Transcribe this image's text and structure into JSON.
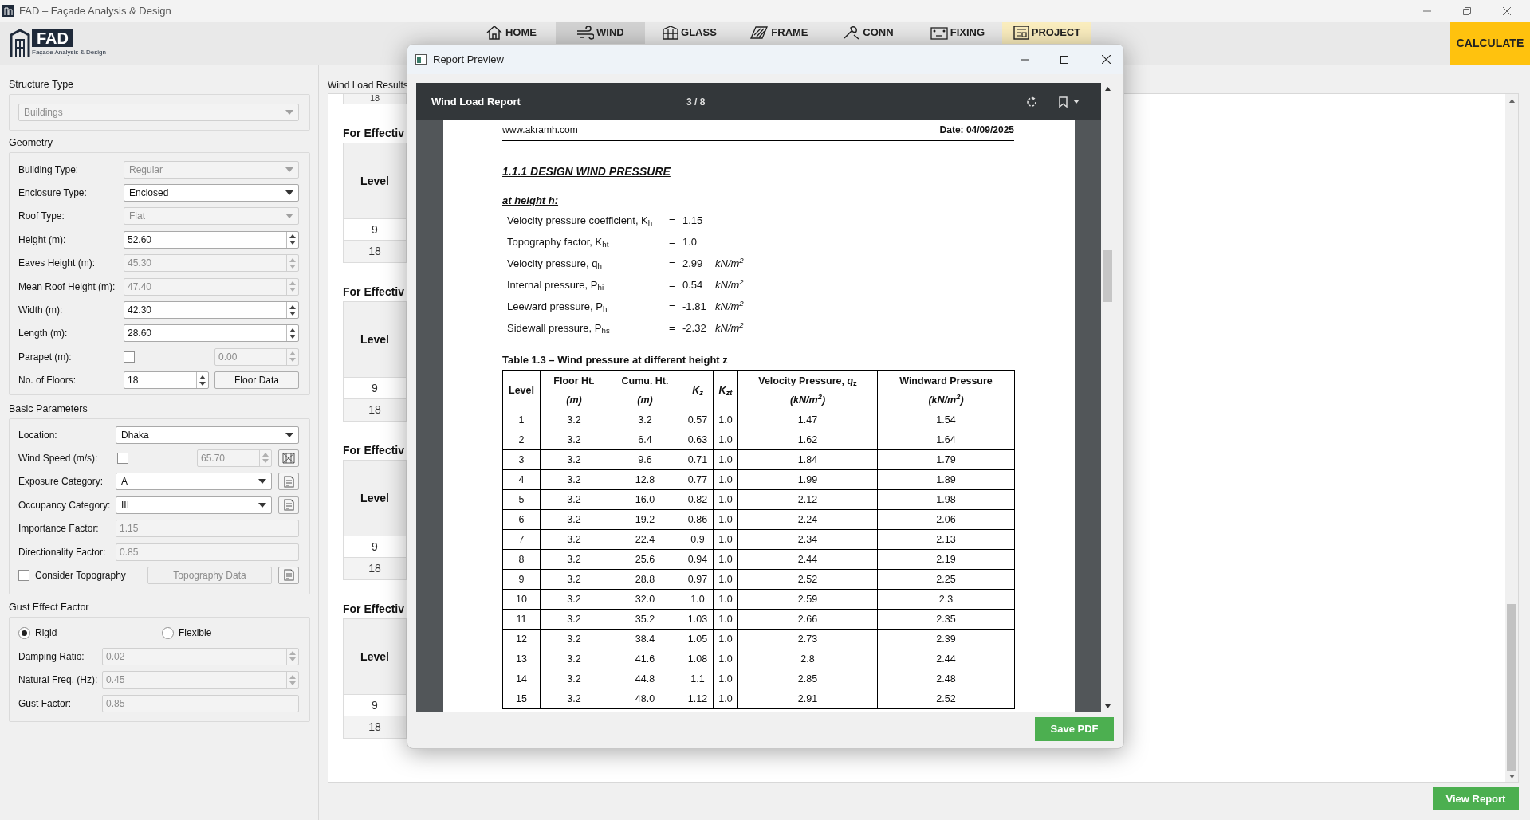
{
  "window": {
    "title": "FAD – Façade Analysis & Design"
  },
  "app_header": {
    "logo_text": "FAD",
    "logo_subtitle": "Façade Analysis & Design",
    "tabs": [
      {
        "label": "HOME",
        "selected": false,
        "highlighted": false
      },
      {
        "label": "WIND",
        "selected": true,
        "highlighted": false
      },
      {
        "label": "GLASS",
        "selected": false,
        "highlighted": false
      },
      {
        "label": "FRAME",
        "selected": false,
        "highlighted": false
      },
      {
        "label": "CONN",
        "selected": false,
        "highlighted": false
      },
      {
        "label": "FIXING",
        "selected": false,
        "highlighted": false
      },
      {
        "label": "PROJECT",
        "selected": false,
        "highlighted": true
      }
    ],
    "calculate_button": "CALCULATE"
  },
  "left_panel": {
    "groups": [
      {
        "title": "Structure Type",
        "rows": [
          {
            "kind": "combo",
            "value": "Buildings",
            "disabled": true
          }
        ]
      },
      {
        "title": "Geometry",
        "rows": [
          {
            "kind": "combo",
            "label": "Building Type:",
            "value": "Regular",
            "disabled": true
          },
          {
            "kind": "combo",
            "label": "Enclosure Type:",
            "value": "Enclosed",
            "disabled": false
          },
          {
            "kind": "combo",
            "label": "Roof Type:",
            "value": "Flat",
            "disabled": true
          },
          {
            "kind": "spin",
            "label": "Height (m):",
            "value": "52.60",
            "disabled": false
          },
          {
            "kind": "spin",
            "label": "Eaves Height (m):",
            "value": "45.30",
            "disabled": true
          },
          {
            "kind": "spin",
            "label": "Mean Roof Height (m):",
            "value": "47.40",
            "disabled": true
          },
          {
            "kind": "spin",
            "label": "Width (m):",
            "value": "42.30",
            "disabled": false
          },
          {
            "kind": "spin",
            "label": "Length (m):",
            "value": "28.60",
            "disabled": false
          },
          {
            "kind": "check_spin",
            "label": "Parapet (m):",
            "checked": false,
            "value": "0.00",
            "disabled": true
          },
          {
            "kind": "spin_button",
            "label": "No. of Floors:",
            "value": "18",
            "disabled": false,
            "button": "Floor Data"
          }
        ]
      },
      {
        "title": "Basic Parameters",
        "rows": [
          {
            "kind": "combo",
            "label": "Location:",
            "value": "Dhaka",
            "disabled": false
          },
          {
            "kind": "check_spin_map",
            "label": "Wind Speed (m/s):",
            "checked": false,
            "value": "65.70",
            "disabled": true
          },
          {
            "kind": "combo_doc",
            "label": "Exposure Category:",
            "value": "A",
            "disabled": false
          },
          {
            "kind": "combo_doc",
            "label": "Occupancy Category:",
            "value": "III",
            "disabled": false
          },
          {
            "kind": "text",
            "label": "Importance Factor:",
            "value": "1.15",
            "disabled": true
          },
          {
            "kind": "text",
            "label": "Directionality Factor:",
            "value": "0.85",
            "disabled": true
          },
          {
            "kind": "check_button_doc",
            "label": "Consider Topography",
            "checked": false,
            "button": "Topography Data",
            "disabled": true
          }
        ]
      },
      {
        "title": "Gust Effect Factor",
        "rows": [
          {
            "kind": "radios",
            "options": [
              {
                "label": "Rigid",
                "selected": true
              },
              {
                "label": "Flexible",
                "selected": false
              }
            ]
          },
          {
            "kind": "spin",
            "label": "Damping Ratio:",
            "value": "0.02",
            "disabled": true
          },
          {
            "kind": "spin",
            "label": "Natural Freq. (Hz):",
            "value": "0.45",
            "disabled": true
          },
          {
            "kind": "text",
            "label": "Gust Factor:",
            "value": "0.85",
            "disabled": true
          }
        ]
      }
    ]
  },
  "results": {
    "label": "Wind Load Results",
    "top_row": "18",
    "sections": [
      {
        "heading": "For Effectiv",
        "header": "Level",
        "rows": [
          "9",
          "18"
        ]
      },
      {
        "heading": "For Effectiv",
        "header": "Level",
        "rows": [
          "9",
          "18"
        ]
      },
      {
        "heading": "For Effectiv",
        "header": "Level",
        "rows": [
          "9",
          "18"
        ]
      },
      {
        "heading": "For Effectiv",
        "header": "Level",
        "rows": [
          "9",
          "18"
        ]
      }
    ],
    "view_report_button": "View Report"
  },
  "dialog": {
    "title": "Report Preview",
    "viewer": {
      "title": "Wind Load Report",
      "page_counter": "3 / 8"
    },
    "page": {
      "site": "www.akramh.com",
      "date": "Date: 04/09/2025",
      "heading": "1.1.1 DESIGN WIND PRESSURE",
      "subheading": "at height h:",
      "params": [
        {
          "label": "Velocity pressure coefficient, K$_{h}$",
          "sign": "=",
          "value": "1.15"
        },
        {
          "label": "Topography factor, K$_{ht}$",
          "sign": "=",
          "value": "1.0"
        },
        {
          "label": "Velocity pressure, q$_{h}$",
          "sign": "=",
          "value": "2.99",
          "unit": "kN/m$^{2}$"
        },
        {
          "label": "Internal pressure, P$_{hi}$",
          "sign": "=",
          "value": "0.54",
          "unit": "kN/m$^{2}$"
        },
        {
          "label": "Leeward pressure, P$_{hl}$",
          "sign": "=",
          "value": "-1.81",
          "unit": "kN/m$^{2}$"
        },
        {
          "label": "Sidewall pressure, P$_{hs}$",
          "sign": "=",
          "value": "-2.32",
          "unit": "kN/m$^{2}$"
        }
      ],
      "table_caption": "Table 1.3 – Wind pressure at different height z",
      "columns": [
        {
          "title": "Level",
          "italic": false
        },
        {
          "title": "Floor Ht.",
          "unit": "(m)",
          "italic": false
        },
        {
          "title": "Cumu. Ht.",
          "unit": "(m)",
          "italic": false
        },
        {
          "title": "K$_{z}$",
          "italic": true
        },
        {
          "title": "K$_{zt}$",
          "italic": true
        },
        {
          "title": "Velocity Pressure, *q*$_{z}$",
          "unit": "(kN/m$^{2}$)",
          "italic": false
        },
        {
          "title": "Windward Pressure",
          "unit": "(kN/m$^{2}$)",
          "italic": false
        }
      ],
      "rows": [
        [
          "1",
          "3.2",
          "3.2",
          "0.57",
          "1.0",
          "1.47",
          "1.54"
        ],
        [
          "2",
          "3.2",
          "6.4",
          "0.63",
          "1.0",
          "1.62",
          "1.64"
        ],
        [
          "3",
          "3.2",
          "9.6",
          "0.71",
          "1.0",
          "1.84",
          "1.79"
        ],
        [
          "4",
          "3.2",
          "12.8",
          "0.77",
          "1.0",
          "1.99",
          "1.89"
        ],
        [
          "5",
          "3.2",
          "16.0",
          "0.82",
          "1.0",
          "2.12",
          "1.98"
        ],
        [
          "6",
          "3.2",
          "19.2",
          "0.86",
          "1.0",
          "2.24",
          "2.06"
        ],
        [
          "7",
          "3.2",
          "22.4",
          "0.9",
          "1.0",
          "2.34",
          "2.13"
        ],
        [
          "8",
          "3.2",
          "25.6",
          "0.94",
          "1.0",
          "2.44",
          "2.19"
        ],
        [
          "9",
          "3.2",
          "28.8",
          "0.97",
          "1.0",
          "2.52",
          "2.25"
        ],
        [
          "10",
          "3.2",
          "32.0",
          "1.0",
          "1.0",
          "2.59",
          "2.3"
        ],
        [
          "11",
          "3.2",
          "35.2",
          "1.03",
          "1.0",
          "2.66",
          "2.35"
        ],
        [
          "12",
          "3.2",
          "38.4",
          "1.05",
          "1.0",
          "2.73",
          "2.39"
        ],
        [
          "13",
          "3.2",
          "41.6",
          "1.08",
          "1.0",
          "2.8",
          "2.44"
        ],
        [
          "14",
          "3.2",
          "44.8",
          "1.1",
          "1.0",
          "2.85",
          "2.48"
        ],
        [
          "15",
          "3.2",
          "48.0",
          "1.12",
          "1.0",
          "2.91",
          "2.52"
        ]
      ]
    },
    "save_button": "Save PDF"
  }
}
